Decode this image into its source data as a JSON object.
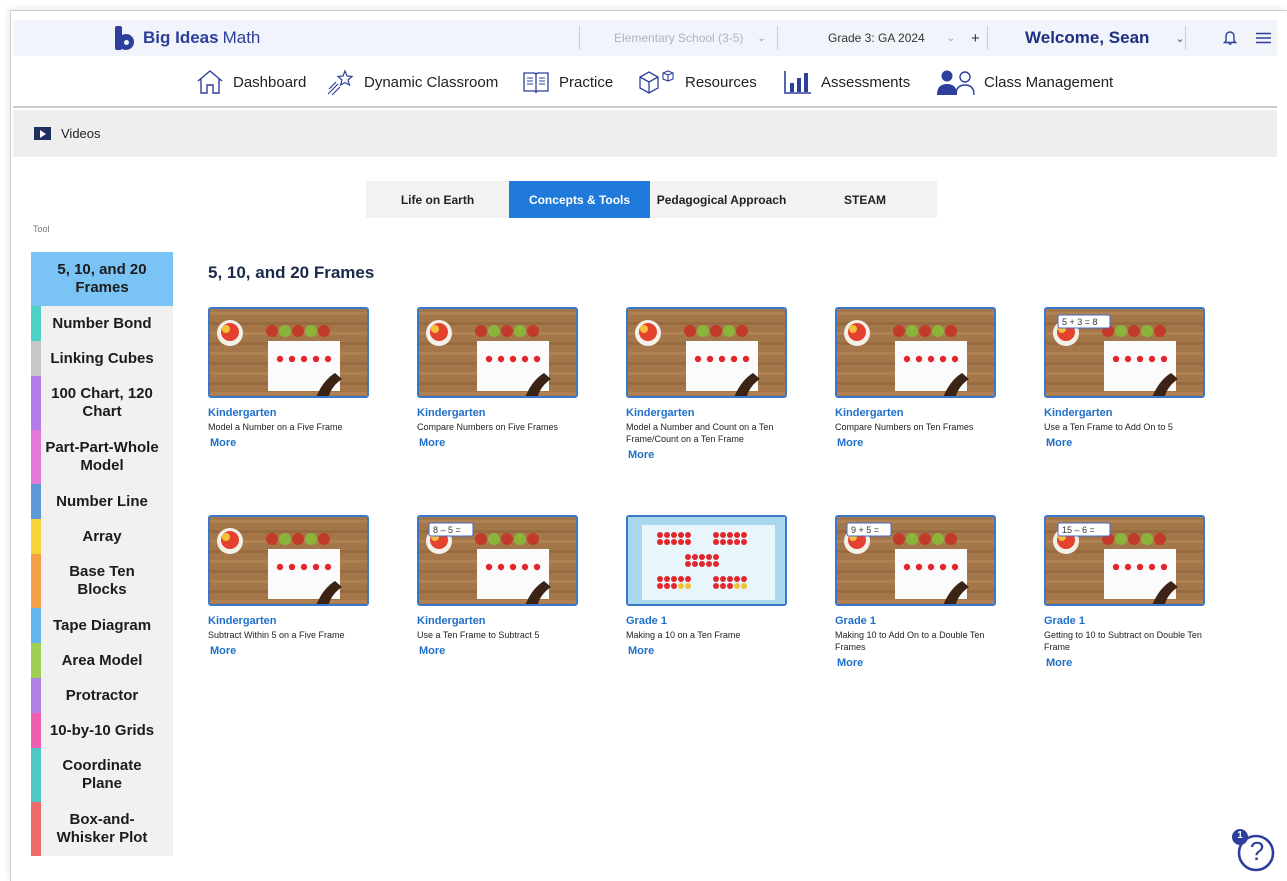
{
  "header": {
    "logo_bold": "Big Ideas",
    "logo_light": "Math",
    "school_select": "Elementary School (3-5)",
    "grade_select": "Grade 3: GA 2024",
    "add_symbol": "+",
    "welcome": "Welcome, Sean"
  },
  "nav": {
    "items": [
      {
        "label": "Dashboard",
        "icon": "house-icon"
      },
      {
        "label": "Dynamic Classroom",
        "icon": "shooting-star-icon"
      },
      {
        "label": "Practice",
        "icon": "book-icon"
      },
      {
        "label": "Resources",
        "icon": "cube-icon"
      },
      {
        "label": "Assessments",
        "icon": "bar-chart-icon"
      },
      {
        "label": "Class Management",
        "icon": "people-icon"
      }
    ]
  },
  "videos_bar": {
    "label": "Videos"
  },
  "tabs": [
    {
      "label": "Life on Earth",
      "active": false
    },
    {
      "label": "Concepts & Tools",
      "active": true
    },
    {
      "label": "Pedagogical Approach",
      "active": false
    },
    {
      "label": "STEAM",
      "active": false
    }
  ],
  "tool_label": "Tool",
  "sidebar": {
    "items": [
      {
        "label": "5, 10, and 20 Frames",
        "color": "#7ac4f5",
        "active": true
      },
      {
        "label": "Number Bond",
        "color": "#4fd1c5"
      },
      {
        "label": "Linking Cubes",
        "color": "#c8c8c8"
      },
      {
        "label": "100 Chart, 120 Chart",
        "color": "#b57bea"
      },
      {
        "label": "Part-Part-Whole Model",
        "color": "#e47ad8"
      },
      {
        "label": "Number Line",
        "color": "#5b9ad6"
      },
      {
        "label": "Array",
        "color": "#f5d33a"
      },
      {
        "label": "Base Ten Blocks",
        "color": "#f5a04a"
      },
      {
        "label": "Tape Diagram",
        "color": "#62b5ef"
      },
      {
        "label": "Area Model",
        "color": "#9fcf52"
      },
      {
        "label": "Protractor",
        "color": "#b17fe6"
      },
      {
        "label": "10-by-10 Grids",
        "color": "#ee5fb2"
      },
      {
        "label": "Coordinate Plane",
        "color": "#4fc9c4"
      },
      {
        "label": "Box-and-Whisker Plot",
        "color": "#ee6a6a"
      }
    ]
  },
  "section_title": "5, 10, and 20 Frames",
  "more_label": "More",
  "cards": [
    {
      "grade": "Kindergarten",
      "desc": "Model a Number on a Five Frame",
      "thumb": "wood",
      "equation": ""
    },
    {
      "grade": "Kindergarten",
      "desc": "Compare Numbers on Five Frames",
      "thumb": "wood",
      "equation": ""
    },
    {
      "grade": "Kindergarten",
      "desc": "Model a Number and Count on a Ten Frame/Count on a Ten Frame",
      "thumb": "wood",
      "equation": ""
    },
    {
      "grade": "Kindergarten",
      "desc": "Compare Numbers on Ten Frames",
      "thumb": "wood",
      "equation": ""
    },
    {
      "grade": "Kindergarten",
      "desc": "Use a Ten Frame to Add On to 5",
      "thumb": "wood",
      "equation": "5 + 3 = 8"
    },
    {
      "grade": "Kindergarten",
      "desc": "Subtract Within 5 on a Five Frame",
      "thumb": "wood",
      "equation": ""
    },
    {
      "grade": "Kindergarten",
      "desc": "Use a Ten Frame to Subtract 5",
      "thumb": "wood",
      "equation": "8 – 5 ="
    },
    {
      "grade": "Grade 1",
      "desc": "Making a 10 on a Ten Frame",
      "thumb": "blue",
      "equation": ""
    },
    {
      "grade": "Grade 1",
      "desc": "Making 10 to Add On to a Double Ten Frames",
      "thumb": "wood",
      "equation": "9 + 5 ="
    },
    {
      "grade": "Grade 1",
      "desc": "Getting to 10 to Subtract on Double Ten Frame",
      "thumb": "wood",
      "equation": "15 – 6 ="
    }
  ],
  "help": {
    "badge": "1",
    "symbol": "?"
  },
  "colors": {
    "accent": "#1f7ad9",
    "link": "#1f6fc9",
    "brand": "#2d3f9a"
  }
}
